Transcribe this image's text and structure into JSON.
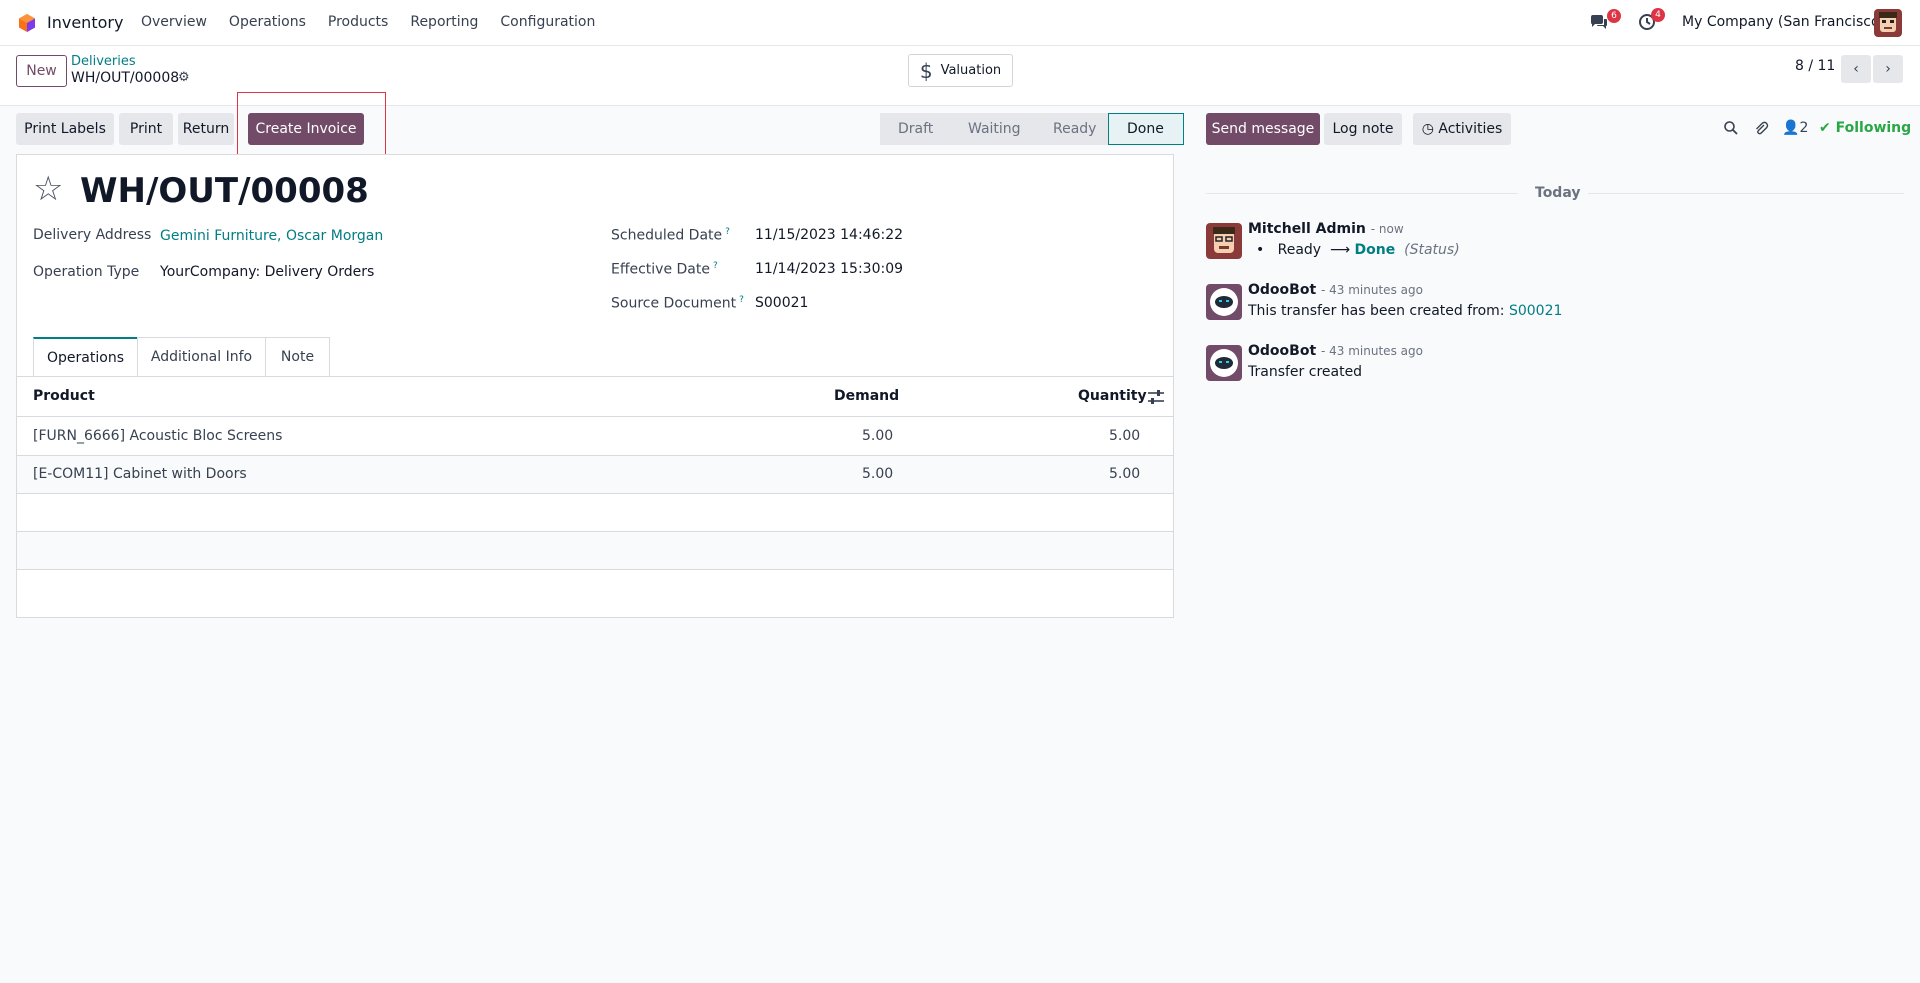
{
  "nav": {
    "app_name": "Inventory",
    "menu": [
      "Overview",
      "Operations",
      "Products",
      "Reporting",
      "Configuration"
    ],
    "messages_count": "6",
    "activities_count": "4",
    "company": "My Company (San Francisco)"
  },
  "control": {
    "new_label": "New",
    "breadcrumb_parent": "Deliveries",
    "breadcrumb_current": "WH/OUT/00008",
    "valuation_label": "Valuation",
    "pager": "8 / 11"
  },
  "actions": {
    "print_labels": "Print Labels",
    "print": "Print",
    "return": "Return",
    "create_invoice": "Create Invoice"
  },
  "status": {
    "stages": [
      "Draft",
      "Waiting",
      "Ready",
      "Done"
    ],
    "current": "Done"
  },
  "record": {
    "title": "WH/OUT/00008",
    "delivery_address_label": "Delivery Address",
    "delivery_address": "Gemini Furniture, Oscar Morgan",
    "operation_type_label": "Operation Type",
    "operation_type": "YourCompany: Delivery Orders",
    "scheduled_date_label": "Scheduled Date",
    "scheduled_date": "11/15/2023 14:46:22",
    "effective_date_label": "Effective Date",
    "effective_date": "11/14/2023 15:30:09",
    "source_document_label": "Source Document",
    "source_document": "S00021",
    "help_mark": "?"
  },
  "tabs": [
    "Operations",
    "Additional Info",
    "Note"
  ],
  "table": {
    "headers": [
      "Product",
      "Demand",
      "Quantity"
    ],
    "rows": [
      {
        "product": "[FURN_6666] Acoustic Bloc Screens",
        "demand": "5.00",
        "quantity": "5.00"
      },
      {
        "product": "[E-COM11] Cabinet with Doors",
        "demand": "5.00",
        "quantity": "5.00"
      }
    ]
  },
  "chatter": {
    "send_message": "Send message",
    "log_note": "Log note",
    "activities": "Activities",
    "followers_count": "2",
    "following": "Following",
    "date_separator": "Today",
    "messages": [
      {
        "author": "Mitchell Admin",
        "time": "- now",
        "from": "Ready",
        "to": "Done",
        "field": "(Status)"
      },
      {
        "author": "OdooBot",
        "time": "- 43 minutes ago",
        "text": "This transfer has been created from: ",
        "link": "S00021"
      },
      {
        "author": "OdooBot",
        "time": "- 43 minutes ago",
        "text": "Transfer created"
      }
    ]
  },
  "colors": {
    "brand": "#714b67",
    "link": "#017e84",
    "badge": "#dc3545",
    "following": "#28a745"
  }
}
